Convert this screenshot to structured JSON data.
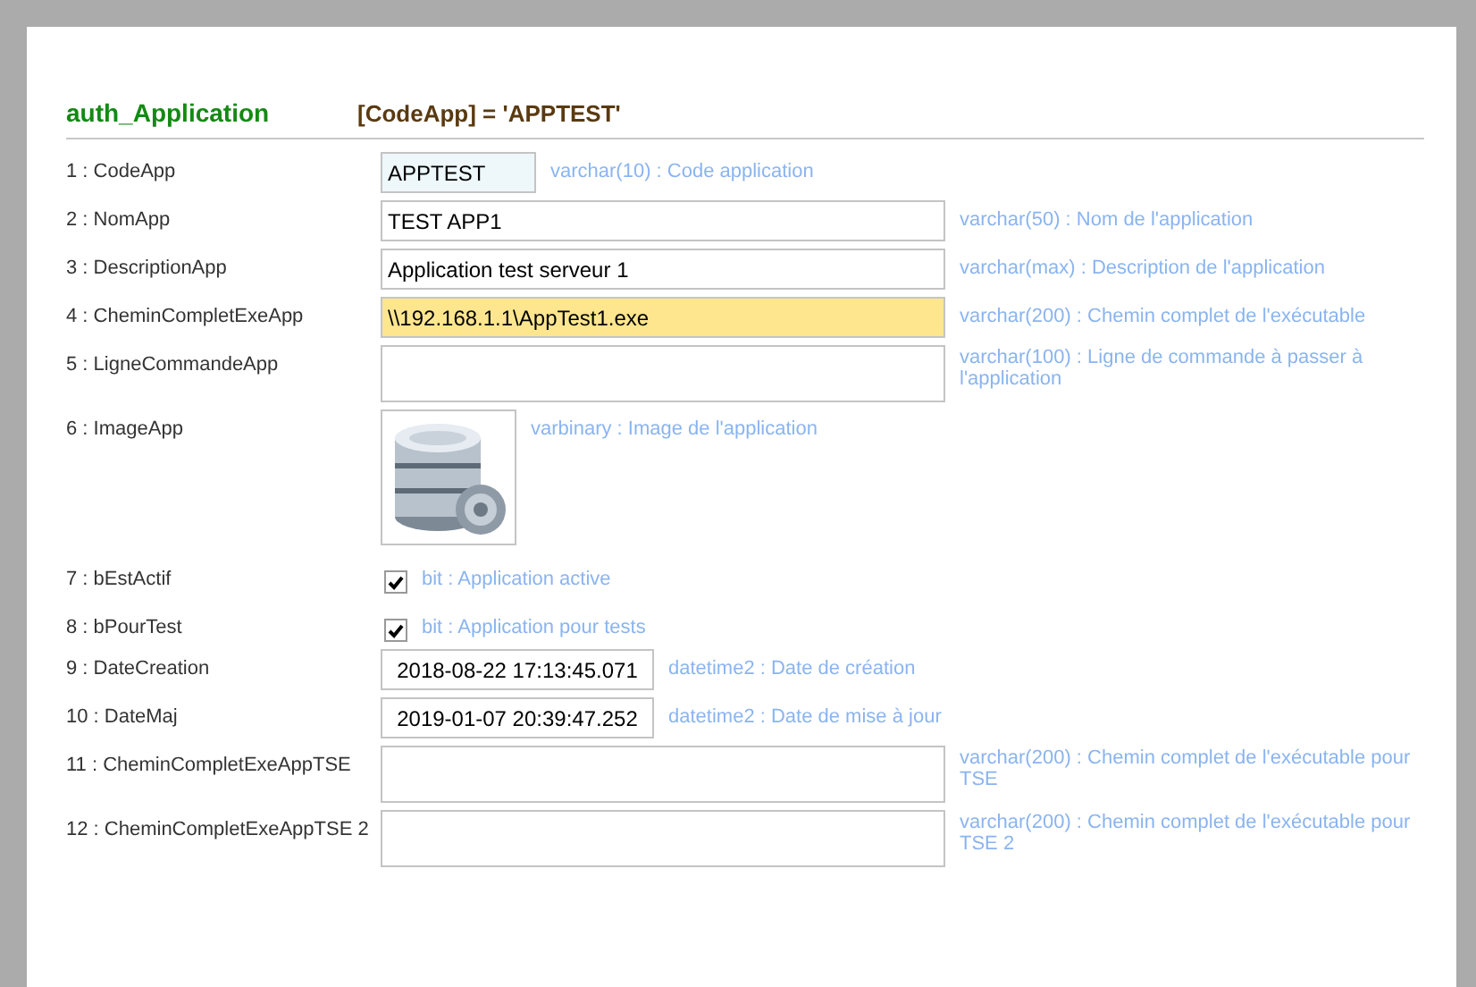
{
  "header": {
    "table": "auth_Application",
    "filter": "[CodeApp] = 'APPTEST'"
  },
  "fields": [
    {
      "label": "1 : CodeApp",
      "kind": "key",
      "value": "APPTEST",
      "focused": false,
      "description": "varchar(10) : Code application"
    },
    {
      "label": "2 : NomApp",
      "kind": "text",
      "value": "TEST APP1",
      "focused": false,
      "description": "varchar(50) : Nom de l'application"
    },
    {
      "label": "3 : DescriptionApp",
      "kind": "text",
      "value": "Application test serveur 1",
      "focused": false,
      "description": "varchar(max) : Description de l'application"
    },
    {
      "label": "4 : CheminCompletExeApp",
      "kind": "text",
      "value": "\\\\192.168.1.1\\AppTest1.exe",
      "focused": true,
      "description": "varchar(200) : Chemin complet de l'exécutable"
    },
    {
      "label": "5 : LigneCommandeApp",
      "kind": "tall",
      "focused": false,
      "description": "varchar(100) : Ligne de commande à passer à l'application"
    },
    {
      "label": "6 : ImageApp",
      "description": "varbinary : Image de l'application"
    },
    {
      "label": "7 : bEstActif",
      "kind": "checkbox",
      "checked": true,
      "description": "bit : Application active"
    },
    {
      "label": "8 : bPourTest",
      "kind": "checkbox",
      "checked": true,
      "description": "bit : Application pour tests"
    },
    {
      "label": "9 : DateCreation",
      "kind": "date",
      "value": "2018-08-22 17:13:45.071",
      "focused": false,
      "description": "datetime2 : Date de création"
    },
    {
      "label": "10 : DateMaj",
      "kind": "date",
      "value": "2019-01-07 20:39:47.252",
      "focused": false,
      "description": "datetime2 : Date de mise à jour"
    },
    {
      "label": "11 : CheminCompletExeAppTSE",
      "kind": "tall",
      "focused": false,
      "description": "varchar(200) : Chemin complet de l'exécutable pour TSE"
    },
    {
      "label": "12 : CheminCompletExeAppTSE 2",
      "kind": "tall",
      "focused": false,
      "description": "varchar(200) : Chemin complet de l'exécutable pour TSE 2"
    }
  ]
}
